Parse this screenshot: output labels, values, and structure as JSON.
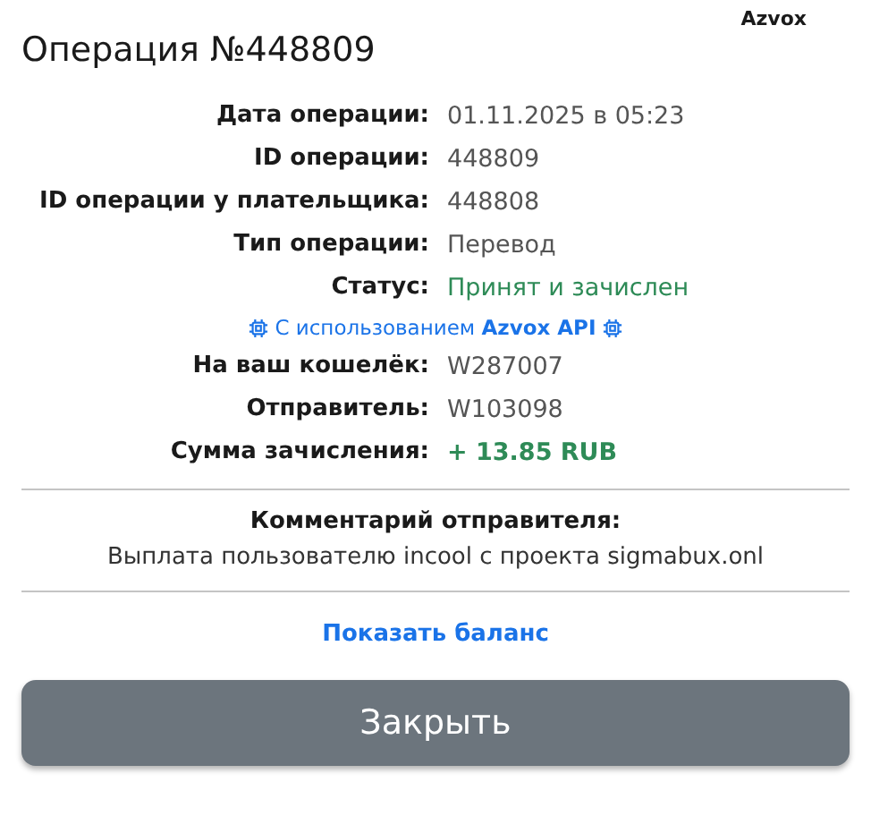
{
  "brand": "Azvox",
  "title": "Операция №448809",
  "details": [
    {
      "kind": "plain",
      "label": "Дата операции:",
      "value": "01.11.2025 в 05:23"
    },
    {
      "kind": "plain",
      "label": "ID операции:",
      "value": "448809"
    },
    {
      "kind": "plain",
      "label": "ID операции у плательщика:",
      "value": "448808"
    },
    {
      "kind": "plain",
      "label": "Тип операции:",
      "value": "Перевод"
    },
    {
      "kind": "status",
      "label": "Статус:",
      "value": "Принят и зачислен"
    },
    {
      "kind": "note",
      "value": "С использованием **Azvox API**"
    },
    {
      "kind": "plain",
      "label": "На ваш кошелёк:",
      "value": "W287007"
    },
    {
      "kind": "plain",
      "label": "Отправитель:",
      "value": "W103098"
    },
    {
      "kind": "amount",
      "label": "Сумма зачисления:",
      "value": "+ 13.85 RUB"
    }
  ],
  "comment": {
    "title": "Комментарий отправителя:",
    "text": "Выплата пользователю incool с проекта sigmabux.onl"
  },
  "link": "Показать баланс",
  "button": "Закрыть"
}
